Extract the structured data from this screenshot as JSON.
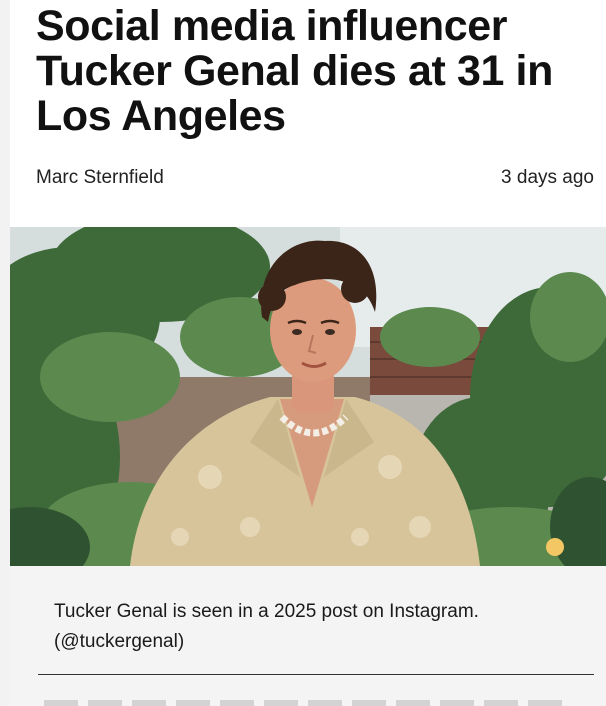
{
  "article": {
    "headline": "Social media influencer Tucker Genal dies at 31 in Los Angeles",
    "author": "Marc Sternfield",
    "timestamp": "3 days ago",
    "photo": {
      "subject": "man-portrait",
      "caption": "Tucker Genal is seen in a 2025 post on Instagram. (@tuckergenal)"
    }
  },
  "colors": {
    "text": "#111111",
    "caption_background": "#f4f4f4",
    "divider": "#333333"
  }
}
